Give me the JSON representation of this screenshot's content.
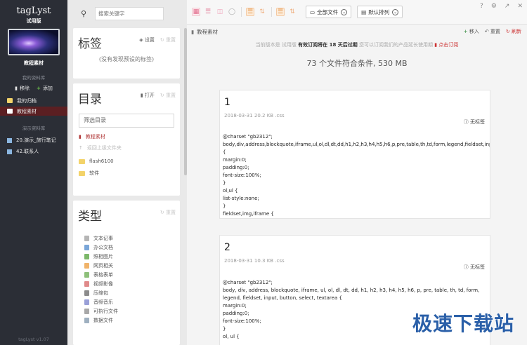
{
  "app": {
    "name": "tagLyst",
    "edition": "试用版",
    "version": "tagLyst v1.07"
  },
  "sidebar": {
    "cover_label": "教程素材",
    "my_libraries_label": "我的资料库",
    "remove_label": "移除",
    "add_label": "添加",
    "items": [
      {
        "label": "我的归档",
        "color": "#f3d36a"
      },
      {
        "label": "教程素材",
        "color": "#ffffff"
      }
    ],
    "demo_libraries_label": "演示资料库",
    "demos": [
      {
        "label": "20.演示_旅行笔记"
      },
      {
        "label": "42.联系人"
      }
    ]
  },
  "search": {
    "placeholder": "搜索关键字"
  },
  "tags_card": {
    "title": "标签",
    "settings_label": "设置",
    "reset_label": "重置",
    "empty_text": "(没有发现预设的标签)"
  },
  "dir_card": {
    "title": "目录",
    "open_label": "打开",
    "reset_label": "重置",
    "filter_placeholder": "筛选目录",
    "current": "教程素材",
    "back": "返回上级文件夹",
    "folders": [
      "flash6100",
      "软件"
    ]
  },
  "type_card": {
    "title": "类型",
    "reset_label": "重置",
    "types": [
      {
        "label": "文本记事",
        "color": "#b5b5b5"
      },
      {
        "label": "办公文档",
        "color": "#7aa6d8"
      },
      {
        "label": "照相图片",
        "color": "#7cb86a"
      },
      {
        "label": "网页相关",
        "color": "#f0b36a"
      },
      {
        "label": "表格表单",
        "color": "#8ec07a"
      },
      {
        "label": "视频影像",
        "color": "#e08a8a"
      },
      {
        "label": "压缩包",
        "color": "#8c8c8c"
      },
      {
        "label": "音频音乐",
        "color": "#9aa0d8"
      },
      {
        "label": "可执行文件",
        "color": "#a8a8a8"
      },
      {
        "label": "数据文件",
        "color": "#9fb0c0"
      }
    ]
  },
  "toolbar": {
    "all_files": "全部文件",
    "sort": "默认排列"
  },
  "breadcrumb": {
    "label": "教程素材",
    "move_in": "移入",
    "reset": "重置",
    "refresh": "刷新"
  },
  "notice": {
    "pre": "当前版本是 试用版",
    "bold": "有效订阅将在 18 天后过期",
    "post": "您可以订阅我们的产品延长使用期",
    "link": "点击订阅"
  },
  "summary": "73 个文件符合条件, 530 MB",
  "files": [
    {
      "num": "1",
      "meta": "2018-03-31  20.2 KB  .css",
      "tag": "无标签",
      "code": "@charset \"gb2312\";\nbody,div,address,blockquote,iframe,ul,ol,dl,dt,dd,h1,h2,h3,h4,h5,h6,p,pre,table,th,td,form,legend,fieldset,inp\n{\nmargin:0;\npadding:0;\nfont-size:100%;\n}\nol,ul {\nlist-style:none;\n}\nfieldset,img,iframe {"
    },
    {
      "num": "2",
      "meta": "2018-03-31  10.3 KB  .css",
      "tag": "无标签",
      "code": "@charset \"gb2312\";\nbody, div, address, blockquote, iframe, ul, ol, dl, dt, dd, h1, h2, h3, h4, h5, h6, p, pre, table, th, td, form,\nlegend, fieldset, input, button, select, textarea {\nmargin:0;\npadding:0;\nfont-size:100%;\n}\nol, ul {"
    }
  ],
  "watermark": "极速下载站"
}
